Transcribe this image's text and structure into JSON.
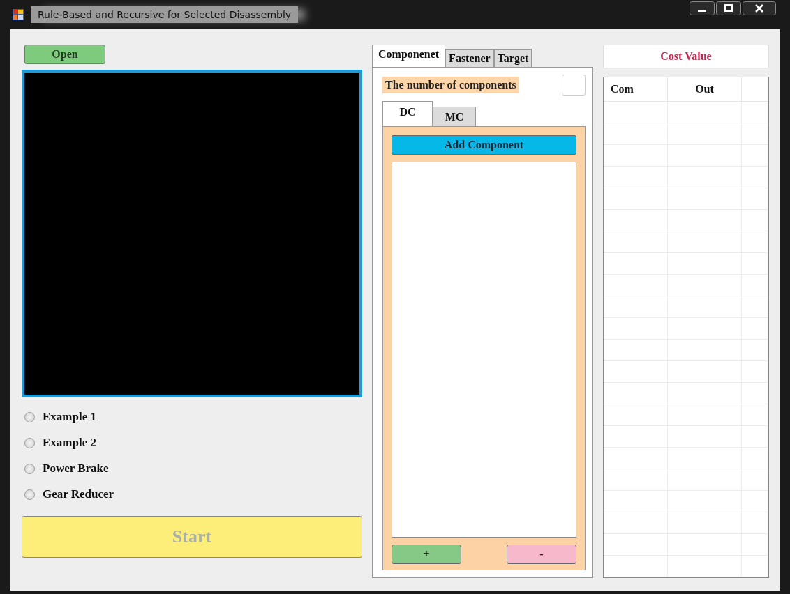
{
  "window": {
    "title": "Rule-Based and Recursive for Selected Disassembly"
  },
  "open_button": {
    "label": "Open"
  },
  "examples": [
    {
      "label": "Example 1",
      "selected": false
    },
    {
      "label": "Example 2",
      "selected": false
    },
    {
      "label": "Power Brake",
      "selected": false
    },
    {
      "label": "Gear Reducer",
      "selected": false
    }
  ],
  "start_button": {
    "label": "Start",
    "disabled": true
  },
  "tabs": [
    {
      "label": "Componenet",
      "selected": true
    },
    {
      "label": "Fastener",
      "selected": false
    },
    {
      "label": "Target",
      "selected": false
    }
  ],
  "components_label": "The number of components",
  "sub_tabs": [
    {
      "label": "DC",
      "selected": true
    },
    {
      "label": "MC",
      "selected": false
    }
  ],
  "add_button": {
    "label": "Add Component"
  },
  "plus_button": {
    "label": "+"
  },
  "minus_button": {
    "label": "-"
  },
  "cost_value": "Cost Value",
  "table": {
    "columns": [
      "Com",
      "Out"
    ]
  }
}
